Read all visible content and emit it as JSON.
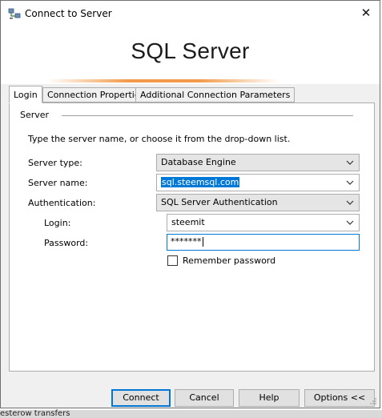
{
  "window": {
    "title": "Connect to Server",
    "close_glyph": "✕",
    "icon": "server-connect-icon"
  },
  "banner": {
    "product": "SQL Server",
    "accent_color": "#f29a4a"
  },
  "tabs": [
    {
      "label": "Login",
      "active": true
    },
    {
      "label": "Connection Properties",
      "active": false
    },
    {
      "label": "Additional Connection Parameters",
      "active": false
    }
  ],
  "server_group": {
    "label": "Server",
    "instruction": "Type the server name, or choose it from the drop-down list."
  },
  "fields": {
    "server_type": {
      "label": "Server type:",
      "value": "Database Engine"
    },
    "server_name": {
      "label": "Server name:",
      "value": "sql.steemsql.com"
    },
    "authentication": {
      "label": "Authentication:",
      "value": "SQL Server Authentication"
    },
    "login": {
      "label": "Login:",
      "value": "steemit"
    },
    "password": {
      "label": "Password:",
      "value": "*******"
    },
    "remember": {
      "label": "Remember password",
      "checked": false
    }
  },
  "buttons": {
    "connect": "Connect",
    "cancel": "Cancel",
    "help": "Help",
    "options": "Options <<"
  },
  "background_text": "esterow transfers",
  "colors": {
    "selection": "#0078d7",
    "focus_border": "#0078d7"
  }
}
